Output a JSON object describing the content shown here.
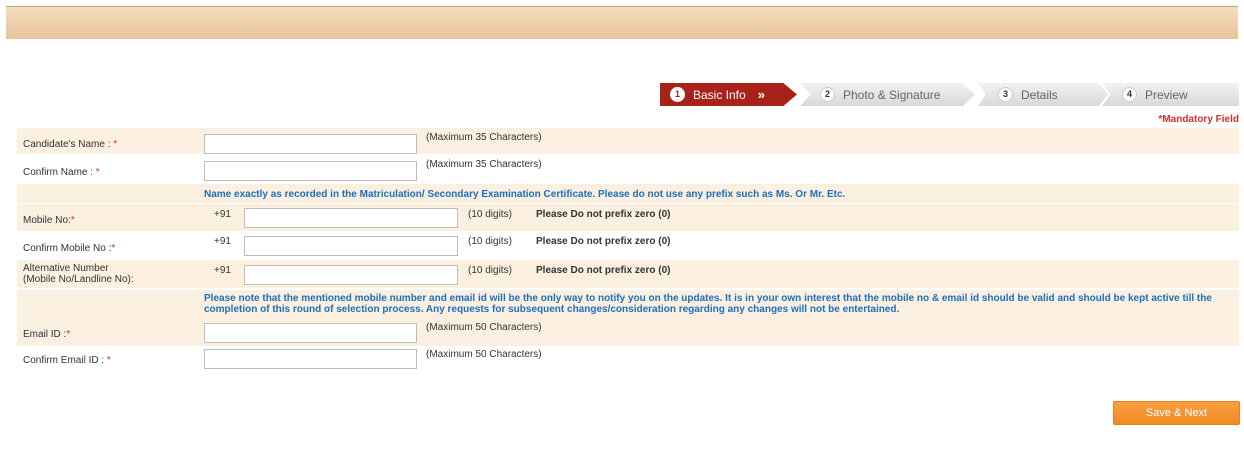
{
  "steps": [
    {
      "num": "1",
      "label": "Basic Info",
      "chevron": "»",
      "active": true
    },
    {
      "num": "2",
      "label": "Photo & Signature",
      "active": false
    },
    {
      "num": "3",
      "label": "Details",
      "active": false
    },
    {
      "num": "4",
      "label": "Preview",
      "active": false
    }
  ],
  "mandatory_note": "*Mandatory Field",
  "form": {
    "candidate_name": {
      "label": "Candidate's Name : ",
      "req": "*",
      "hint": "(Maximum 35 Characters)",
      "value": ""
    },
    "confirm_name": {
      "label": "Confirm Name : ",
      "req": "*",
      "hint": "(Maximum 35 Characters)",
      "value": ""
    },
    "name_note": "Name exactly as recorded in the Matriculation/ Secondary Examination Certificate. Please do not use any prefix such as Ms. Or Mr. Etc.",
    "mobile": {
      "label": "Mobile No:",
      "req": "*",
      "prefix": "+91",
      "hint": "(10 digits)",
      "warning": "Please Do not prefix zero (0)",
      "value": ""
    },
    "confirm_mobile": {
      "label": "Confirm Mobile No :",
      "req": "*",
      "prefix": "+91",
      "hint": "(10 digits)",
      "warning": "Please Do not prefix zero (0)",
      "value": ""
    },
    "alt_number": {
      "label_line1": "Alternative Number",
      "label_line2": "(Mobile No/Landline No):",
      "prefix": "+91",
      "hint": "(10 digits)",
      "warning": "Please Do not prefix zero (0)",
      "value": ""
    },
    "contact_note": "Please note that the mentioned mobile number and email id will be the only way to notify you on the updates. It is in your own interest that the mobile no & email id should be valid and should be kept active till the completion of this round of selection process. Any requests for subsequent changes/consideration regarding any changes will not be entertained.",
    "email": {
      "label": "Email ID :",
      "req": "*",
      "hint": "(Maximum 50 Characters)",
      "value": ""
    },
    "confirm_email": {
      "label": "Confirm Email ID : ",
      "req": "*",
      "hint": "(Maximum 50 Characters)",
      "value": ""
    }
  },
  "buttons": {
    "save_next": "Save & Next"
  },
  "colors": {
    "accent": "#a82219",
    "button": "#f08a22",
    "row_shade": "#fbf0e0",
    "note": "#1a6fc0",
    "required": "#d32f2f"
  }
}
